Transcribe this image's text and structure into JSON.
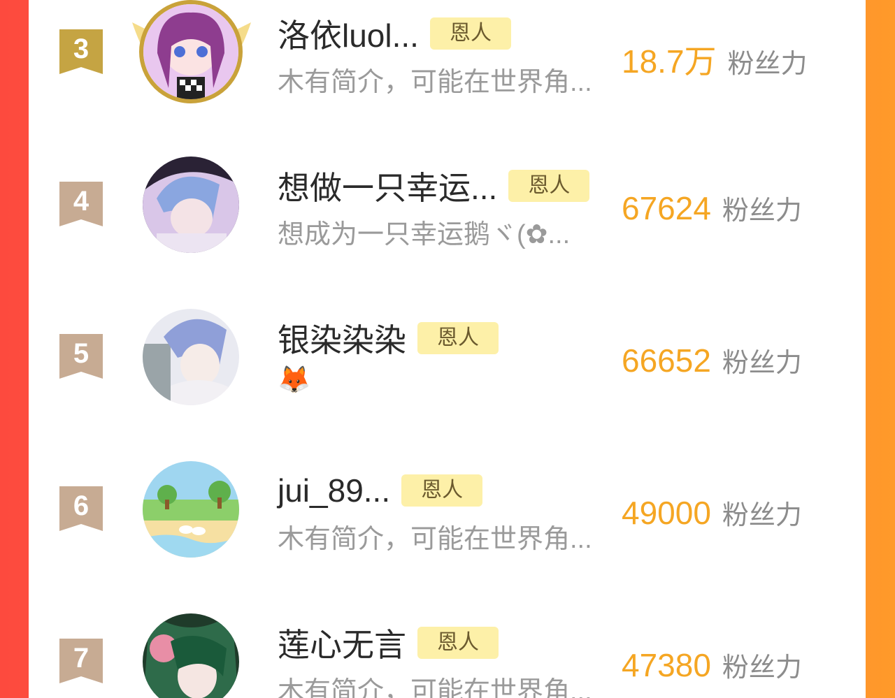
{
  "rows": [
    {
      "rank": "3",
      "name": "洛依luol...",
      "tag": "恩人",
      "desc": "木有简介，可能在世界角...",
      "fans_value": "18.7万",
      "fans_label": "粉丝力",
      "avatar": "purple-hair-girl-avatar",
      "top3": true
    },
    {
      "rank": "4",
      "name": "想做一只幸运...",
      "tag": "恩人",
      "desc": "想成为一只幸运鹅ヾ(✿...",
      "fans_value": "67624",
      "fans_label": "粉丝力",
      "avatar": "blue-hair-boy-avatar"
    },
    {
      "rank": "5",
      "name": "银染染染",
      "tag": "恩人",
      "desc": "🦊",
      "fans_value": "66652",
      "fans_label": "粉丝力",
      "avatar": "blue-hair-boy-avatar-2"
    },
    {
      "rank": "6",
      "name": "jui_89...",
      "tag": "恩人",
      "desc": "木有简介，可能在世界角...",
      "fans_value": "49000",
      "fans_label": "粉丝力",
      "avatar": "beach-scene-avatar"
    },
    {
      "rank": "7",
      "name": "莲心无言",
      "tag": "恩人",
      "desc": "木有简介，可能在世界角...",
      "fans_value": "47380",
      "fans_label": "粉丝力",
      "avatar": "green-hair-girl-avatar"
    }
  ],
  "colors": {
    "gold_badge": "#c5a443",
    "bronze_badge": "#c7ab93",
    "fans": "#f5a623",
    "tag_bg": "#fdf0a8"
  }
}
